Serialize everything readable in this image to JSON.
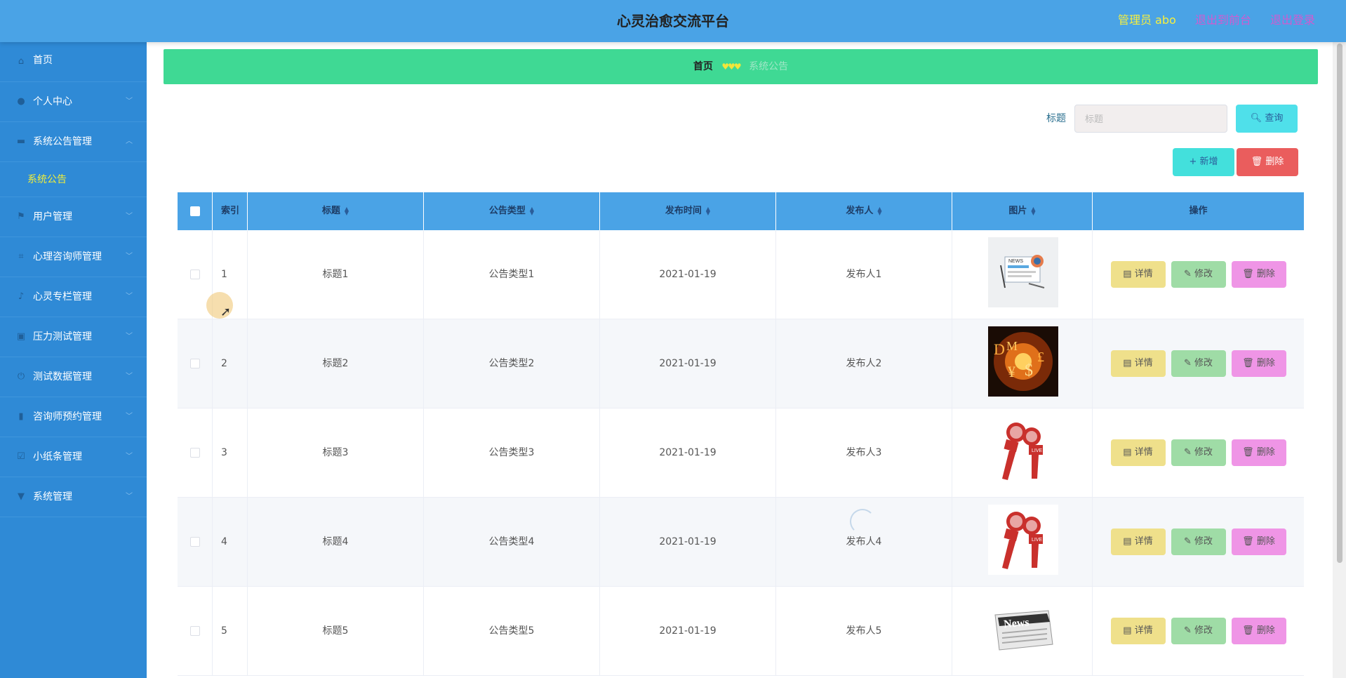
{
  "header": {
    "title": "心灵治愈交流平台",
    "admin_label": "管理员 abo",
    "front_link": "退出到前台",
    "logout_link": "退出登录"
  },
  "sidebar": {
    "items": [
      {
        "label": "首页",
        "icon": "home-icon"
      },
      {
        "label": "个人中心",
        "icon": "user-icon"
      },
      {
        "label": "系统公告管理",
        "icon": "ticket-icon",
        "expanded": true
      },
      {
        "label": "用户管理",
        "icon": "flag-icon"
      },
      {
        "label": "心理咨询师管理",
        "icon": "crop-icon"
      },
      {
        "label": "心灵专栏管理",
        "icon": "microphone-icon"
      },
      {
        "label": "压力测试管理",
        "icon": "briefcase-icon"
      },
      {
        "label": "测试数据管理",
        "icon": "power-icon"
      },
      {
        "label": "咨询师预约管理",
        "icon": "bar-chart-icon"
      },
      {
        "label": "小纸条管理",
        "icon": "check-box-icon"
      },
      {
        "label": "系统管理",
        "icon": "trophy-icon"
      }
    ],
    "submenu": {
      "label": "系统公告"
    }
  },
  "breadcrumb": {
    "home": "首页",
    "separator": "♥♥♥",
    "current": "系统公告"
  },
  "search": {
    "label": "标题",
    "placeholder": "标题",
    "query_button": "查询"
  },
  "toolbar": {
    "add_button": "新增",
    "delete_button": "删除"
  },
  "table": {
    "headers": {
      "index": "索引",
      "title": "标题",
      "type": "公告类型",
      "date": "发布时间",
      "publisher": "发布人",
      "image": "图片",
      "operation": "操作"
    },
    "rows": [
      {
        "index": "1",
        "title": "标题1",
        "type": "公告类型1",
        "date": "2021-01-19",
        "publisher": "发布人1",
        "image": "news-illustration"
      },
      {
        "index": "2",
        "title": "标题2",
        "type": "公告类型2",
        "date": "2021-01-19",
        "publisher": "发布人2",
        "image": "currency-symbols"
      },
      {
        "index": "3",
        "title": "标题3",
        "type": "公告类型3",
        "date": "2021-01-19",
        "publisher": "发布人3",
        "image": "news-microphones"
      },
      {
        "index": "4",
        "title": "标题4",
        "type": "公告类型4",
        "date": "2021-01-19",
        "publisher": "发布人4",
        "image": "news-microphones"
      },
      {
        "index": "5",
        "title": "标题5",
        "type": "公告类型5",
        "date": "2021-01-19",
        "publisher": "发布人5",
        "image": "newspaper"
      }
    ],
    "actions": {
      "detail": "详情",
      "edit": "修改",
      "delete": "删除"
    }
  },
  "colors": {
    "header_bg": "#4aa3e6",
    "sidebar_bg": "#2f8ad6",
    "breadcrumb_bg": "#3fd994",
    "active_submenu": "#f0ee3a"
  }
}
